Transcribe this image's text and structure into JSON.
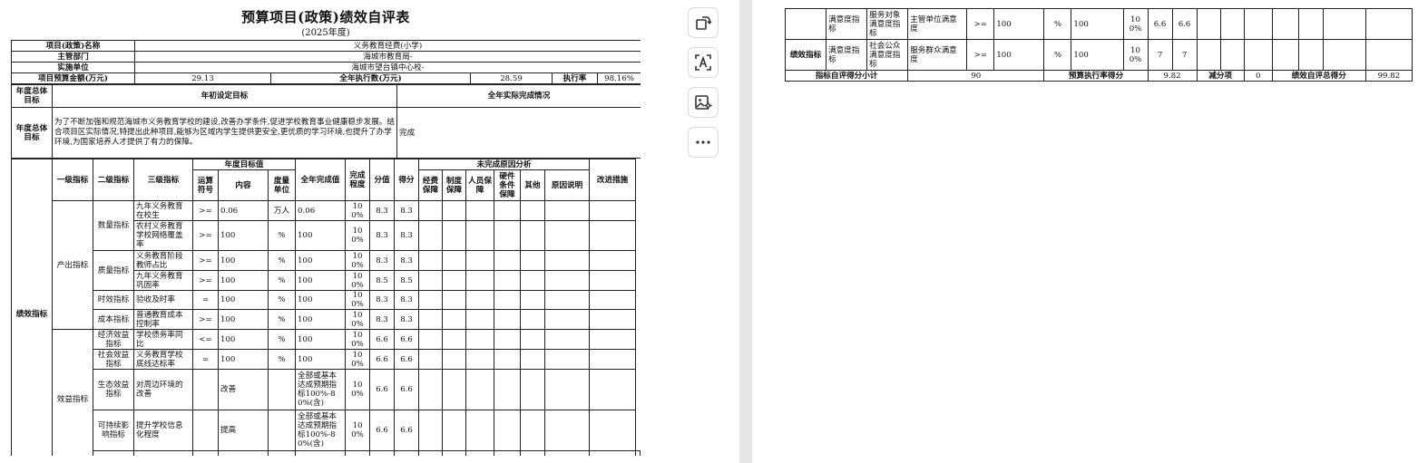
{
  "doc": {
    "title": "预算项目(政策)绩效自评表",
    "year": "(2025年度)"
  },
  "info": {
    "project_label": "项目(政策)名称",
    "project_value": "义务教育经费(小学)",
    "dept_label": "主管部门",
    "dept_value": "海城市教育局-",
    "unit_label": "实施单位",
    "unit_value": "海城市望台镇中心校-",
    "budget_label": "项目预算金额(万元)",
    "budget_value": "29.13",
    "exec_label": "全年执行数(万元)",
    "exec_value": "28.59",
    "rate_label": "执行率",
    "rate_value": "98.16%"
  },
  "goals": {
    "label": "年度总体目标",
    "initial_header": "年初设定目标",
    "actual_header": "全年实际完成情况",
    "initial_text": "为了不断加强和规范海城市义务教育学校的建设,改善办学条件,促进学校教育事业健康稳步发展。结合项目区实际情况,特提出此种项目,能够为区域内学生提供更安全,更优质的学习环境,也提升了办学环境,为国家培养人才提供了有力的保障。",
    "actual_text": "完成"
  },
  "headers": {
    "perf": "绩效指标",
    "l1": "一级指标",
    "l2": "二级指标",
    "l3": "三级指标",
    "target": "年度目标值",
    "op": "运算符号",
    "content": "内容",
    "unit": "度量单位",
    "actual": "全年完成值",
    "degree": "完成程度",
    "score_full": "分值",
    "score": "得分",
    "reason": "未完成原因分析",
    "r1": "经费保障",
    "r2": "制度保障",
    "r3": "人员保障",
    "r4": "硬件条件保障",
    "r5": "其他",
    "r6": "原因说明",
    "improve": "改进措施"
  },
  "groups": {
    "output": "产出指标",
    "benefit": "效益指标",
    "quantity": "数量指标",
    "quality": "质量指标",
    "time": "时效指标",
    "cost": "成本指标",
    "econ": "经济效益指标",
    "social": "社会效益指标",
    "eco": "生态效益指标",
    "sustain": "可持续影响指标"
  },
  "rows": [
    {
      "l3": "九年义务教育在校生",
      "op": ">=",
      "content": "0.06",
      "unit": "万人",
      "actual": "0.06",
      "degree": "100%",
      "full": "8.3",
      "score": "8.3"
    },
    {
      "l3": "农村义务教育学校网络覆盖率",
      "op": ">=",
      "content": "100",
      "unit": "%",
      "actual": "100",
      "degree": "100%",
      "full": "8.3",
      "score": "8.3"
    },
    {
      "l3": "义务教育阶段教师占比",
      "op": ">=",
      "content": "100",
      "unit": "%",
      "actual": "100",
      "degree": "100%",
      "full": "8.3",
      "score": "8.3"
    },
    {
      "l3": "九年义务教育巩固率",
      "op": ">=",
      "content": "100",
      "unit": "%",
      "actual": "100",
      "degree": "100%",
      "full": "8.5",
      "score": "8.5"
    },
    {
      "l3": "验收及时率",
      "op": "=",
      "content": "100",
      "unit": "%",
      "actual": "100",
      "degree": "100%",
      "full": "8.3",
      "score": "8.3"
    },
    {
      "l3": "普通教育成本控制率",
      "op": ">=",
      "content": "100",
      "unit": "%",
      "actual": "100",
      "degree": "100%",
      "full": "8.3",
      "score": "8.3"
    },
    {
      "l3": "学校债务率同比",
      "op": "<=",
      "content": "100",
      "unit": "%",
      "actual": "100",
      "degree": "100%",
      "full": "6.6",
      "score": "6.6"
    },
    {
      "l3": "义务教育学校底线达标率",
      "op": "=",
      "content": "100",
      "unit": "%",
      "actual": "100",
      "degree": "100%",
      "full": "6.6",
      "score": "6.6"
    },
    {
      "l3": "对周边环境的改善",
      "op": "",
      "content": "改善",
      "unit": "",
      "actual": "全部或基本达成预期指标100%-80%(含)",
      "degree": "100%",
      "full": "6.6",
      "score": "6.6"
    },
    {
      "l3": "提升学校信息化程度",
      "op": "",
      "content": "提高",
      "unit": "",
      "actual": "全部或基本达成预期指标100%-80%(含)",
      "degree": "100%",
      "full": "6.6",
      "score": "6.6"
    }
  ],
  "page2": {
    "perf": "绩效指标",
    "sat_l1": "满意度指标",
    "rows": [
      {
        "l2": "服务对象满意度指标",
        "l3": "主管单位满意度",
        "op": ">=",
        "content": "100",
        "unit": "%",
        "actual": "100",
        "degree": "100%",
        "full": "6.6",
        "score": "6.6"
      },
      {
        "l2": "社会公众满意度指标",
        "l3": "服务群众满意度",
        "op": ">=",
        "content": "100",
        "unit": "%",
        "actual": "100",
        "degree": "100%",
        "full": "7",
        "score": "7"
      }
    ],
    "summary": {
      "subtotal_label": "指标自评得分小计",
      "subtotal_value": "90",
      "budget_rate_label": "预算执行率得分",
      "budget_rate_value": "9.82",
      "deduct_label": "减分项",
      "deduct_value": "0",
      "total_label": "绩效自评总得分",
      "total_value": "99.82"
    }
  },
  "toolbar": {
    "icons": [
      "rotate-icon",
      "text-recognition-icon",
      "image-ai-icon",
      "more-icon"
    ]
  }
}
